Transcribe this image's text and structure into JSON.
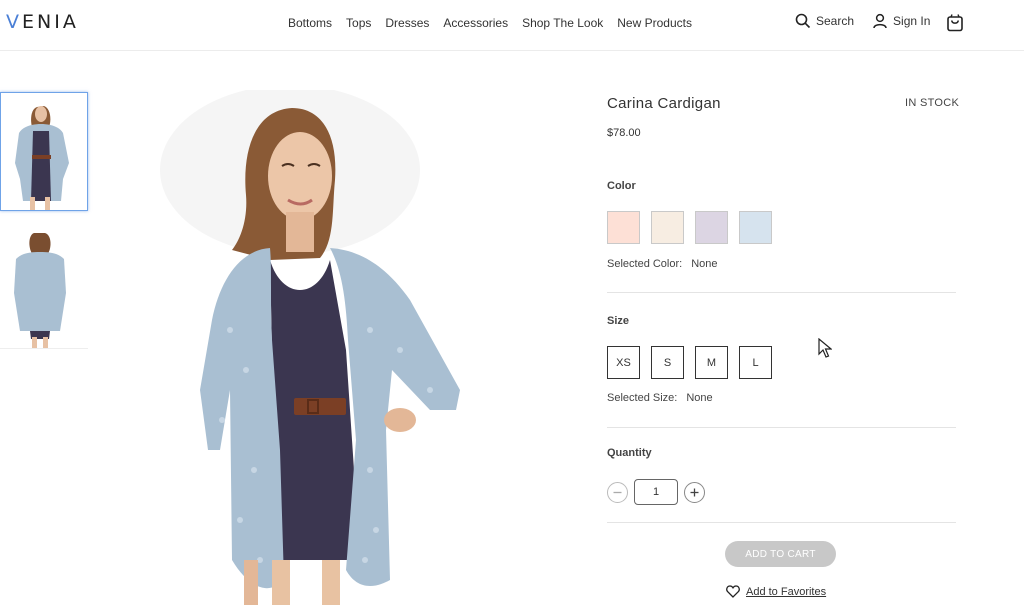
{
  "brand": {
    "logo": "VENIA"
  },
  "nav": [
    "Bottoms",
    "Tops",
    "Dresses",
    "Accessories",
    "Shop The Look",
    "New Products"
  ],
  "header": {
    "search_label": "Search",
    "signin_label": "Sign In"
  },
  "product": {
    "title": "Carina Cardigan",
    "stock": "IN STOCK",
    "price": "$78.00",
    "color": {
      "label": "Color",
      "selected_label": "Selected Color:",
      "selected_value": "None",
      "swatches": [
        "#fde0d6",
        "#f7ede2",
        "#dcd5e3",
        "#d6e3ee"
      ]
    },
    "size": {
      "label": "Size",
      "options": [
        "XS",
        "S",
        "M",
        "L"
      ],
      "selected_label": "Selected Size:",
      "selected_value": "None"
    },
    "quantity": {
      "label": "Quantity",
      "value": "1"
    },
    "add_to_cart": "ADD TO CART",
    "favorites": "Add to Favorites"
  },
  "colors": {
    "accent": "#4a7fd6",
    "button_disabled": "#c8c8c8",
    "cardigan": "#a9bfd2",
    "dress": "#3b3650"
  }
}
